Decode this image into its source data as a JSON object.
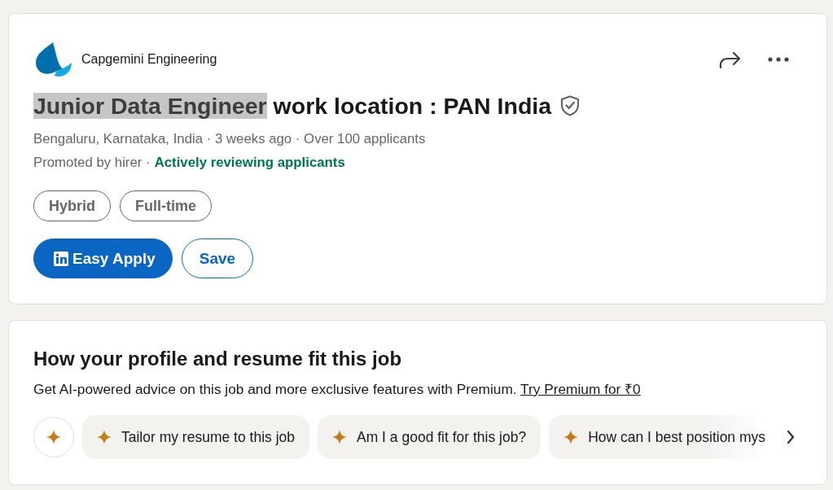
{
  "job_card": {
    "company": "Capgemini Engineering",
    "title": [
      {
        "text": "Junior Data Engineer",
        "highlighted": true
      },
      {
        "text": "work location : PAN India",
        "highlighted": false
      }
    ],
    "verified": true,
    "meta": "Bengaluru, Karnataka, India · 3 weeks ago · Over 100 applicants",
    "promoted": "Promoted by hirer ·",
    "hiring_status": "Actively reviewing applicants",
    "tags": [
      "Hybrid",
      "Full-time"
    ],
    "buttons": [
      {
        "label": "Easy Apply",
        "kind": "primary"
      },
      {
        "label": "Save",
        "kind": "secondary"
      }
    ]
  },
  "fit_card": {
    "heading": "How your profile and resume fit this job",
    "description": "Get AI-powered advice on this job and more exclusive features with Premium.",
    "link": "Try Premium for ₹0",
    "prompts": [
      "Tailor my resume to this job",
      "Am I a good fit for this job?",
      "How can I best position mys"
    ]
  }
}
